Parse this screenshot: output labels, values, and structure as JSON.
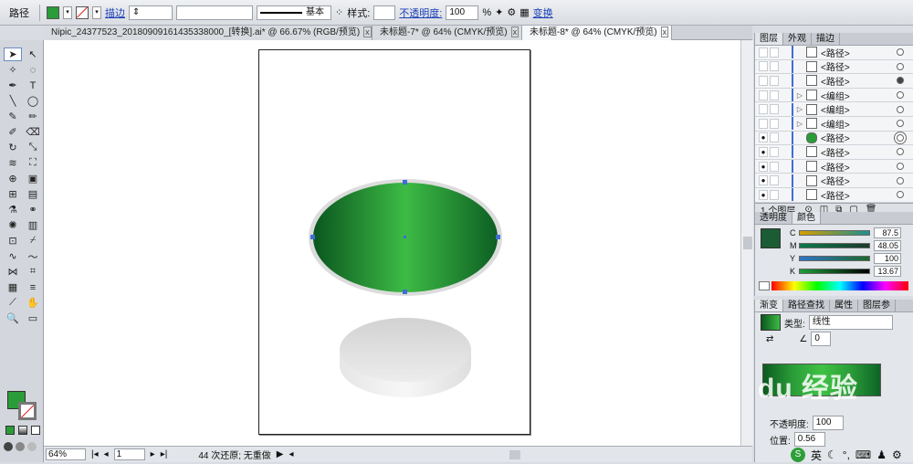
{
  "control_bar": {
    "object_type": "路径",
    "stroke_label": "描边",
    "stroke_profile": "基本",
    "style_label": "样式:",
    "opacity_label": "不透明度:",
    "opacity_value": "100",
    "opacity_unit": "%",
    "transform_label": "变换"
  },
  "tabs": [
    {
      "label": "Nipic_24377523_20180909161435338000_[转换].ai* @ 66.67% (RGB/预览)"
    },
    {
      "label": "未标题-7* @ 64% (CMYK/预览)"
    },
    {
      "label": "未标题-8* @ 64% (CMYK/预览)"
    }
  ],
  "status_bar": {
    "zoom": "64%",
    "artboard": "1",
    "message": "44 次还原; 无重做"
  },
  "layers_panel": {
    "tabs": [
      "图层",
      "外观",
      "描边"
    ],
    "rows": [
      {
        "name": "<路径>",
        "expand": "",
        "target": "empty"
      },
      {
        "name": "<路径>",
        "expand": "",
        "target": "empty"
      },
      {
        "name": "<路径>",
        "expand": "",
        "target": "filled"
      },
      {
        "name": "<编组>",
        "expand": "▷",
        "target": "empty"
      },
      {
        "name": "<编组>",
        "expand": "▷",
        "target": "empty"
      },
      {
        "name": "<编组>",
        "expand": "▷",
        "target": "empty"
      },
      {
        "name": "<路径>",
        "expand": "",
        "target": "selected"
      },
      {
        "name": "<路径>",
        "expand": "",
        "target": "empty"
      },
      {
        "name": "<路径>",
        "expand": "",
        "target": "empty"
      },
      {
        "name": "<路径>",
        "expand": "",
        "target": "empty"
      },
      {
        "name": "<路径>",
        "expand": "",
        "target": "empty"
      }
    ],
    "footer": "1 个图层"
  },
  "color_panel": {
    "tabs": [
      "透明度",
      "颜色"
    ],
    "channels": [
      {
        "label": "C",
        "value": "87.5"
      },
      {
        "label": "M",
        "value": "48.05"
      },
      {
        "label": "Y",
        "value": "100"
      },
      {
        "label": "K",
        "value": "13.67"
      }
    ]
  },
  "gradient_panel": {
    "tabs": [
      "渐变",
      "路径查找",
      "属性",
      "图层参"
    ],
    "type_label": "类型:",
    "type_value": "线性",
    "angle_value": "0",
    "opacity_label": "不透明度:",
    "opacity_value": "100",
    "location_label": "位置:",
    "location_value": "0.56"
  },
  "taskbar": {
    "ime": "英"
  },
  "watermark": "du 经验",
  "colors": {
    "ellipse_dark": "#0c5a20",
    "ellipse_light": "#3dbb45",
    "disc_gray": "#d9d9d9",
    "selection_blue": "#3f6fd3"
  }
}
